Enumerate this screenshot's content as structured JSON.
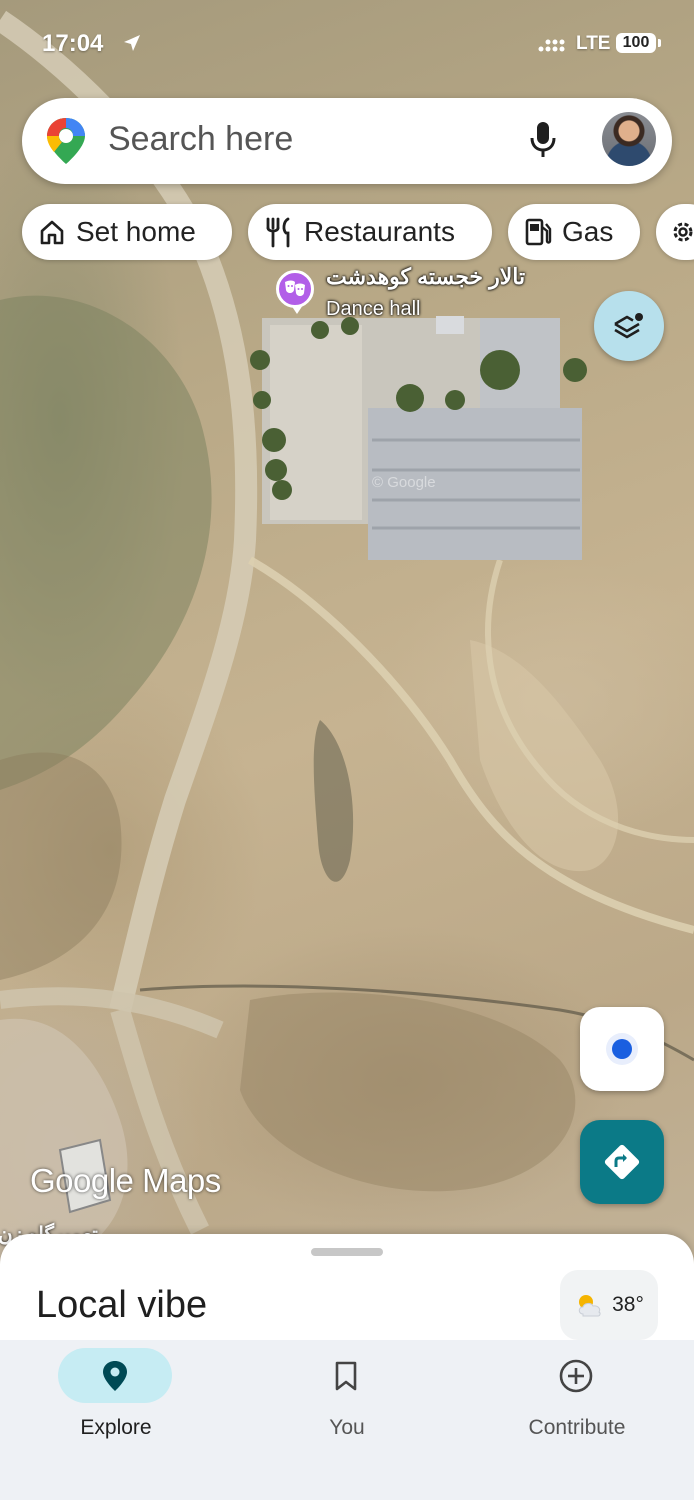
{
  "status_bar": {
    "time": "17:04",
    "network": "LTE",
    "battery": "100"
  },
  "search": {
    "placeholder": "Search here"
  },
  "chips": [
    {
      "label": "Set home",
      "icon": "home-icon"
    },
    {
      "label": "Restaurants",
      "icon": "fork-knife-icon"
    },
    {
      "label": "Gas",
      "icon": "gas-pump-icon"
    }
  ],
  "map": {
    "poi": {
      "name_fa": "تالار خجسته کوهدشت",
      "category": "Dance hall",
      "icon": "theater-masks-icon",
      "color": "#b25ee8"
    },
    "watermark": "Google Maps",
    "imagery_mark": "© Google",
    "edge_label": "تعمیرگاه زن"
  },
  "buttons": {
    "layers": "layers-icon",
    "my_location": "my-location-icon",
    "directions": "directions-icon"
  },
  "sheet": {
    "title": "Local vibe",
    "weather": {
      "temperature": "38°",
      "icon": "partly-cloudy-icon"
    }
  },
  "nav": [
    {
      "label": "Explore",
      "icon": "map-pin-icon",
      "active": true
    },
    {
      "label": "You",
      "icon": "bookmark-icon",
      "active": false
    },
    {
      "label": "Contribute",
      "icon": "plus-circle-icon",
      "active": false
    }
  ],
  "colors": {
    "accent": "#0b7a87",
    "nav_active": "#c6ecf3",
    "poi": "#b25ee8"
  }
}
